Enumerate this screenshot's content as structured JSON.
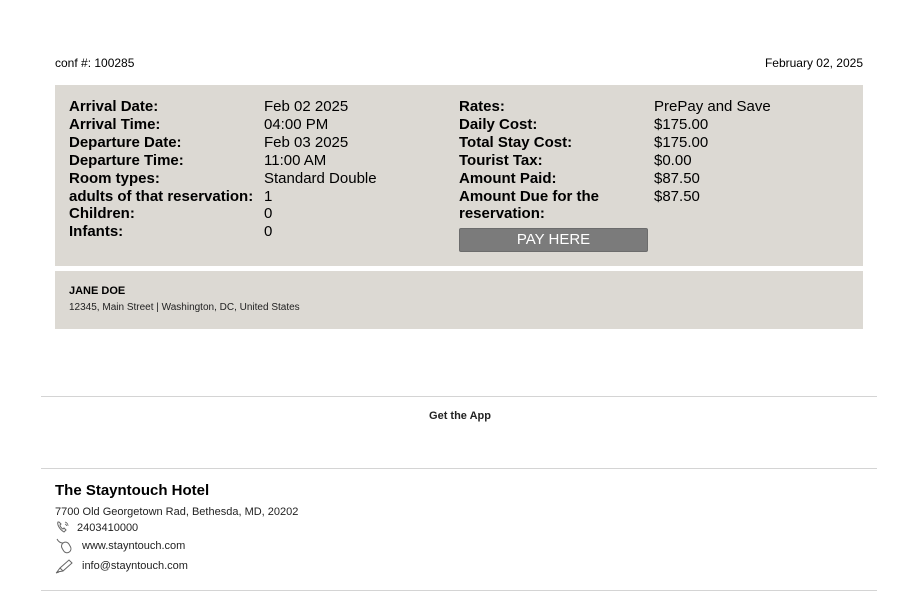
{
  "header": {
    "conf": "conf #: 100285",
    "date": "February 02, 2025"
  },
  "reservation": {
    "left": [
      {
        "label": "Arrival Date:",
        "value": "Feb 02 2025"
      },
      {
        "label": "Arrival Time:",
        "value": "04:00 PM"
      },
      {
        "label": "Departure Date:",
        "value": "Feb 03 2025"
      },
      {
        "label": "Departure Time:",
        "value": "11:00 AM"
      },
      {
        "label": "Room types:",
        "value": "Standard Double"
      },
      {
        "label": "adults of that reservation:",
        "value": "1"
      },
      {
        "label": "Children:",
        "value": "0"
      },
      {
        "label": "Infants:",
        "value": "0"
      }
    ],
    "right": [
      {
        "label": "Rates:",
        "value": "PrePay and Save"
      },
      {
        "label": "Daily Cost:",
        "value": "$175.00"
      },
      {
        "label": "Total Stay Cost:",
        "value": "$175.00"
      },
      {
        "label": "Tourist Tax:",
        "value": "$0.00"
      },
      {
        "label": "Amount Paid:",
        "value": "$87.50"
      },
      {
        "label": "Amount Due for the reservation:",
        "value": "$87.50"
      }
    ],
    "pay_button": "PAY HERE"
  },
  "guest": {
    "name": "JANE DOE",
    "address": "12345, Main Street | Washington, DC, United States"
  },
  "footer": {
    "get_app": "Get the App",
    "hotel_name": "The Stayntouch Hotel",
    "hotel_address": "7700 Old Georgetown Rad, Bethesda, MD, 20202",
    "phone": "2403410000",
    "website": "www.stayntouch.com",
    "email": "info@stayntouch.com",
    "icons": {
      "phone": "phone-icon",
      "web": "mouse-icon",
      "mail": "pen-icon"
    }
  }
}
